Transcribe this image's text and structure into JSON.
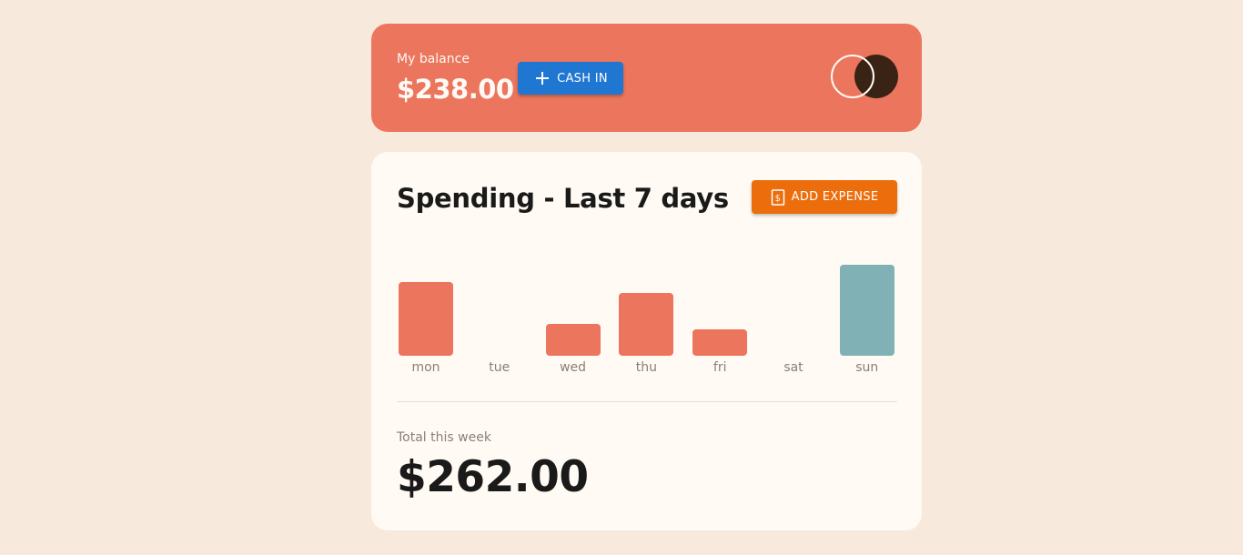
{
  "balance": {
    "label": "My balance",
    "amount": "$238.00",
    "cash_in_label": "CASH IN",
    "logo_icon": "two-circles-logo-icon"
  },
  "spending": {
    "title": "Spending - Last 7 days",
    "add_expense_label": "ADD EXPENSE",
    "add_expense_icon": "receipt-dollar-icon",
    "total_label": "Total this week",
    "total_amount": "$262.00"
  },
  "colors": {
    "background": "#f8e9dd",
    "balance_card": "#ec755d",
    "cash_in_button": "#1f77d2",
    "add_expense_button": "#ec6d0c",
    "bar": "#ec755d",
    "bar_highlight": "#80b1b5"
  },
  "chart_data": {
    "type": "bar",
    "categories": [
      "mon",
      "tue",
      "wed",
      "thu",
      "fri",
      "sat",
      "sun"
    ],
    "values": [
      78,
      0,
      34,
      66,
      28,
      0,
      96
    ],
    "highlight_index": 6
  }
}
